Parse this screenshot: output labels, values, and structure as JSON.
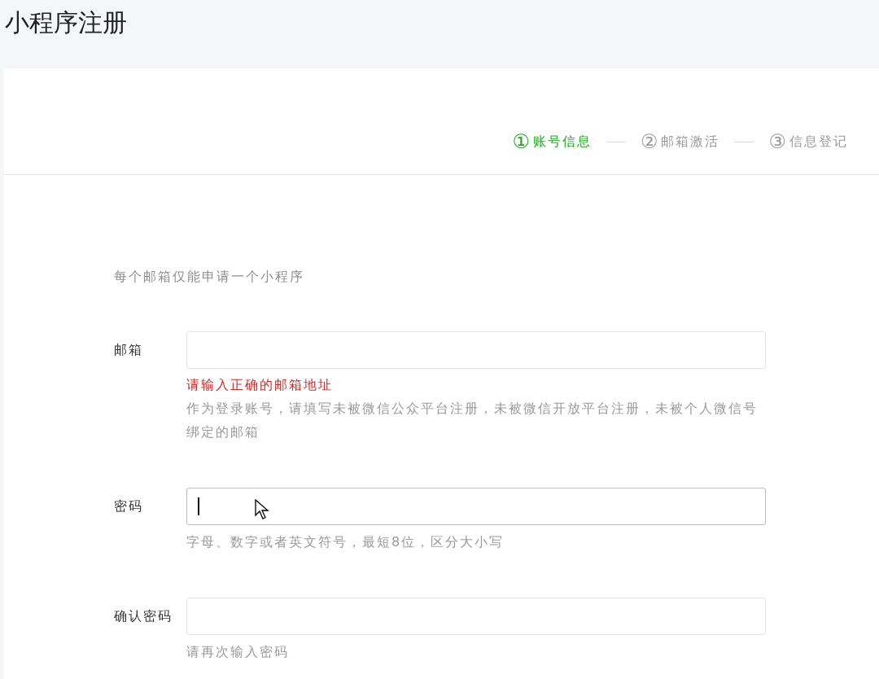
{
  "page_title": "小程序注册",
  "steps": [
    {
      "number": "①",
      "label": "账号信息",
      "selected": true
    },
    {
      "number": "②",
      "label": "邮箱激活",
      "selected": false
    },
    {
      "number": "③",
      "label": "信息登记",
      "selected": false
    }
  ],
  "notice": "每个邮箱仅能申请一个小程序",
  "fields": [
    {
      "label": "邮箱",
      "focused": false,
      "error": "请输入正确的邮箱地址",
      "hint": "作为登录账号，请填写未被微信公众平台注册，未被微信开放平台注册，未被个人微信号绑定的邮箱"
    },
    {
      "label": "密码",
      "focused": true,
      "hint": "字母、数字或者英文符号，最短8位，区分大小写"
    },
    {
      "label": "确认密码",
      "focused": false,
      "hint": "请再次输入密码"
    }
  ]
}
